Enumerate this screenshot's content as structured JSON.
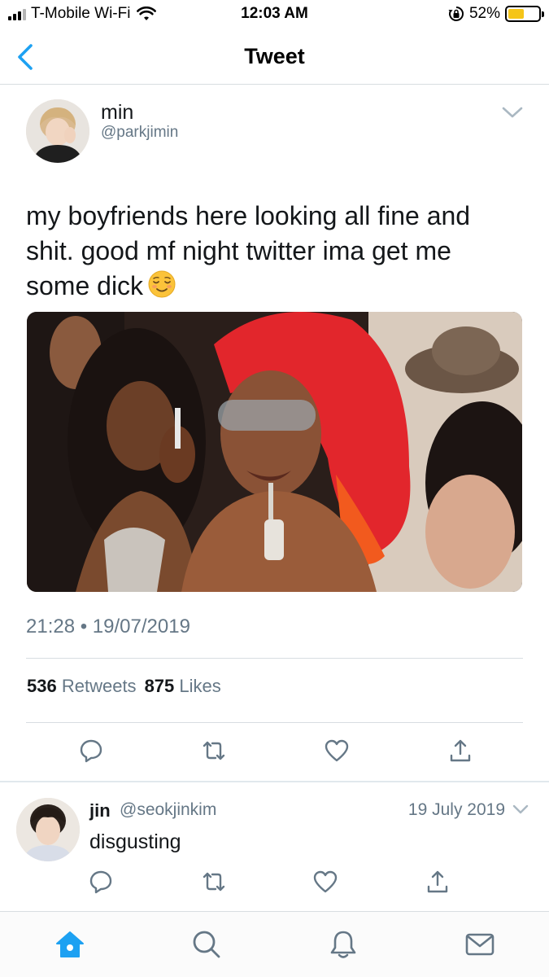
{
  "status_bar": {
    "carrier": "T-Mobile Wi-Fi",
    "time": "12:03 AM",
    "battery": "52%",
    "battery_level": 0.52
  },
  "nav": {
    "title": "Tweet"
  },
  "tweet": {
    "author_name": "min",
    "author_handle": "@parkjimin",
    "text": "my boyfriends here looking all fine and shit. good mf night twitter ima get me some dick",
    "timestamp": "21:28 • 19/07/2019",
    "retweets_count": "536",
    "retweets_label": "Retweets",
    "likes_count": "875",
    "likes_label": "Likes"
  },
  "reply": {
    "author_name": "jin",
    "author_handle": "@seokjinkim",
    "date": "19 July 2019",
    "text": "disgusting"
  },
  "colors": {
    "accent": "#1da1f2",
    "secondary_text": "#657786",
    "primary_text": "#14171a",
    "divider": "#d8dde1",
    "battery_fill": "#f5c518"
  },
  "icons": {
    "status": [
      "signal-icon",
      "wifi-icon",
      "lock-rotation-icon",
      "battery-icon"
    ],
    "nav": [
      "back-chevron-icon"
    ],
    "tweet_actions": [
      "reply-icon",
      "retweet-icon",
      "like-icon",
      "share-icon"
    ],
    "tabs": [
      "home-icon",
      "search-icon",
      "notifications-icon",
      "messages-icon"
    ]
  }
}
